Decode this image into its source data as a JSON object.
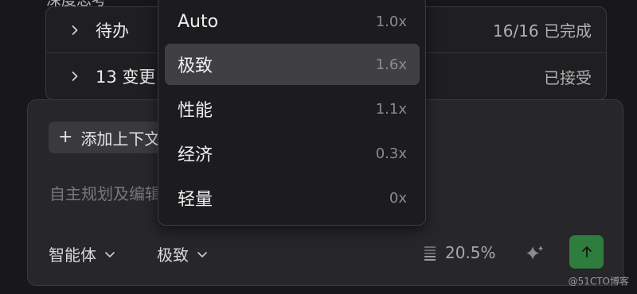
{
  "task_list": {
    "top_partial_label": "深度思考",
    "rows": [
      {
        "label": "待办",
        "status": "16/16 已完成"
      },
      {
        "label": "13 变更",
        "status": "已接受"
      }
    ]
  },
  "composer": {
    "add_context_label": "添加上下文",
    "placeholder": "自主规划及编辑",
    "agent_selector": "智能体",
    "mode_selector": "极致",
    "context_usage": "20.5%",
    "send_color": "#2e7d3e"
  },
  "mode_menu": {
    "options": [
      {
        "name": "Auto",
        "multiplier": "1.0x"
      },
      {
        "name": "极致",
        "multiplier": "1.6x",
        "selected": true
      },
      {
        "name": "性能",
        "multiplier": "1.1x"
      },
      {
        "name": "经济",
        "multiplier": "0.3x"
      },
      {
        "name": "轻量",
        "multiplier": "0x"
      }
    ]
  },
  "watermark": "@51CTO博客"
}
